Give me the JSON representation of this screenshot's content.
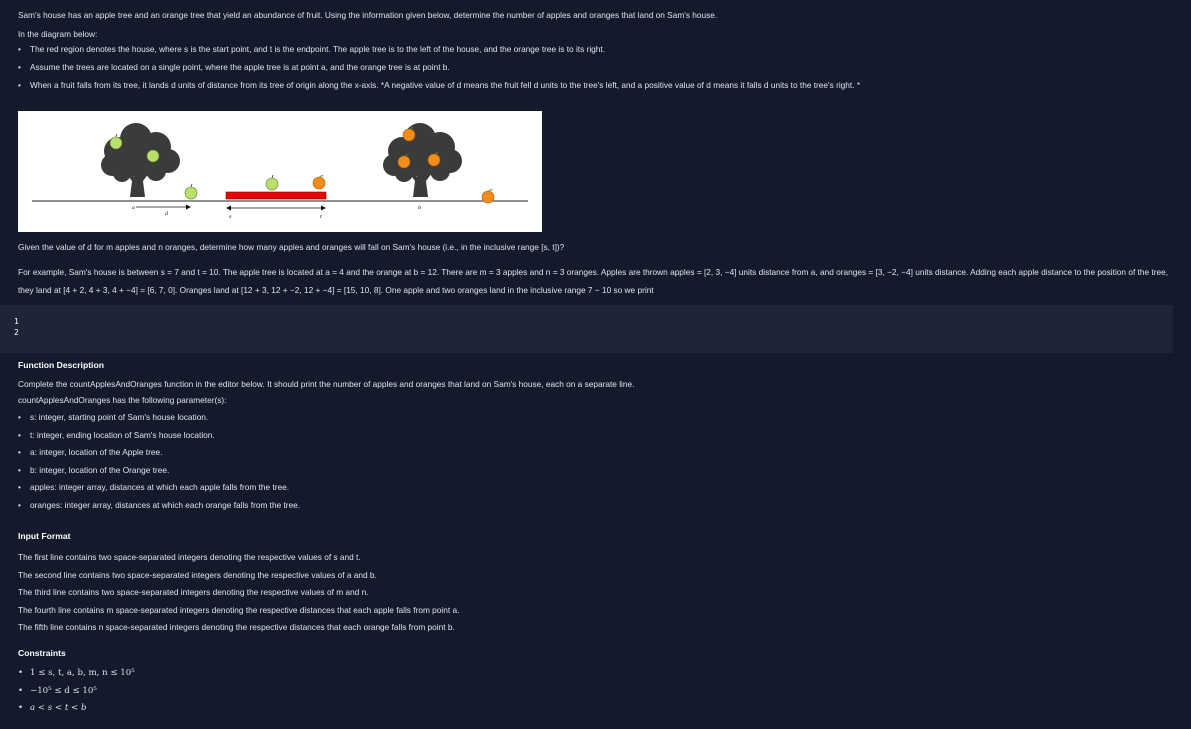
{
  "intro": {
    "problem": "Sam's house has an apple tree and an orange tree that yield an abundance of fruit. Using the information given below, determine the number of apples and oranges that land on Sam's house.",
    "diagram_heading": "In the diagram below:",
    "bullets": [
      "The red region denotes the house, where s is the start point, and t is the endpoint. The apple tree is to the left of the house, and the orange tree is to its right.",
      "Assume the trees are located on a single point, where the apple tree is at point a, and the orange tree is at point b.",
      "When a fruit falls from its tree, it lands d units of distance from its tree of origin along the x-axis. *A negative value of d means the fruit fell d units to the tree's left, and a positive value of d means it falls d units to the tree's right. *"
    ]
  },
  "diagram": {
    "labels": {
      "a": "a",
      "d": "d",
      "s": "s",
      "t": "t",
      "b": "b"
    },
    "colors": {
      "house": "#e10600",
      "tree": "#3b3b3b",
      "apple": "#b9e06a",
      "orange": "#f28c1a"
    }
  },
  "given": "Given the value of d for m apples and n oranges, determine how many apples and oranges will fall on Sam's house (i.e., in the inclusive range [s, t])?",
  "example": "For example, Sam's house is between s = 7 and t = 10. The apple tree is located at a = 4 and the orange at b = 12. There are m = 3 apples and n = 3 oranges. Apples are thrown apples = [2, 3, −4] units distance from a, and oranges = [3, −2, −4] units distance. Adding each apple distance to the position of the tree, they land at [4 + 2, 4 + 3, 4 + −4] = [6, 7, 0]. Oranges land at [12 + 3, 12 + −2, 12 + −4] = [15, 10, 8]. One apple and two oranges land in the inclusive range 7 − 10 so we print",
  "code_output": [
    "1",
    "2"
  ],
  "function_description": {
    "heading": "Function Description",
    "text": "Complete the countApplesAndOranges function in the editor below. It should print the number of apples and oranges that land on Sam's house, each on a separate line.",
    "params_heading": "countApplesAndOranges has the following parameter(s):",
    "params": [
      "s: integer, starting point of Sam's house location.",
      "t: integer, ending location of Sam's house location.",
      "a: integer, location of the Apple tree.",
      "b: integer, location of the Orange tree.",
      "apples: integer array, distances at which each apple falls from the tree.",
      "oranges: integer array, distances at which each orange falls from the tree."
    ]
  },
  "input_format": {
    "heading": "Input Format",
    "lines": [
      "The first line contains two space-separated integers denoting the respective values of s and t.",
      "The second line contains two space-separated integers denoting the respective values of a and b.",
      "The third line contains two space-separated integers denoting the respective values of m and n.",
      "The fourth line contains m space-separated integers denoting the respective distances that each apple falls from point a.",
      "The fifth line contains n space-separated integers denoting the respective distances that each orange falls from point b."
    ]
  },
  "constraints": {
    "heading": "Constraints",
    "items": [
      "1 ≤ s, t, a, b, m, n ≤ 10⁵",
      "−10⁵ ≤ d ≤ 10⁵",
      "a < s < t < b"
    ]
  }
}
